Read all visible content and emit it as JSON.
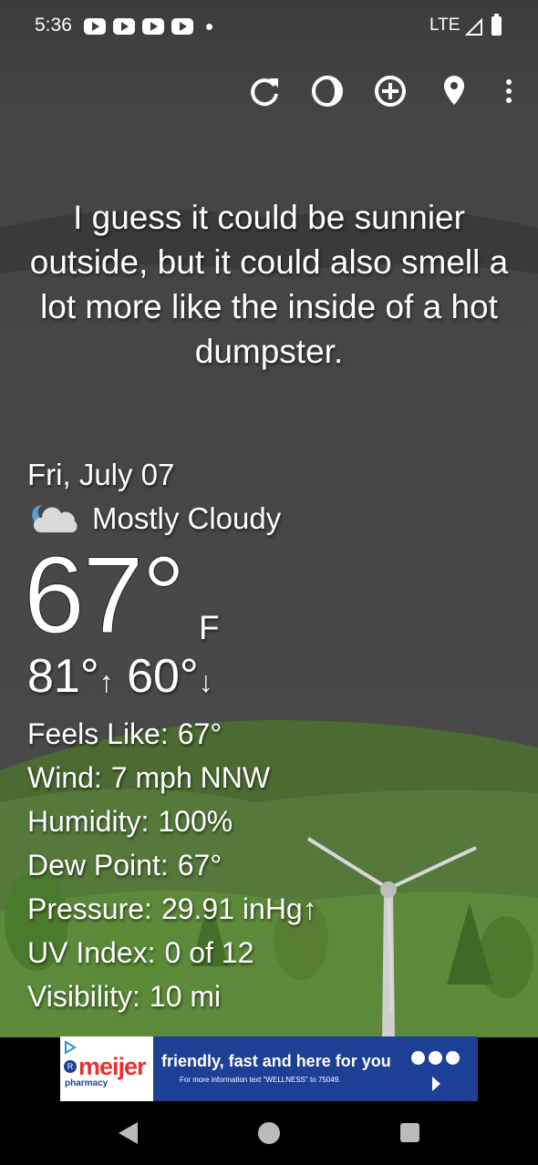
{
  "status_bar": {
    "time": "5:36",
    "notification_icons": [
      "youtube-icon",
      "youtube-icon",
      "youtube-icon",
      "youtube-icon"
    ],
    "network": "LTE"
  },
  "toolbar": {
    "icons": [
      "refresh-icon",
      "theme-icon",
      "add-location-icon",
      "location-pin-icon",
      "more-options-icon"
    ]
  },
  "quote": "I guess it could be sunnier outside, but it could also smell a lot more like the inside of a hot dumpster.",
  "weather": {
    "date": "Fri, July 07",
    "condition": "Mostly Cloudy",
    "condition_icon": "partly-cloudy-night-icon",
    "temperature": "67°",
    "unit": "F",
    "high": "81°",
    "high_arrow": "↑",
    "low": "60°",
    "low_arrow": "↓",
    "details": [
      {
        "label": "Feels Like:",
        "value": "67°"
      },
      {
        "label": "Wind:",
        "value": "7 mph NNW"
      },
      {
        "label": "Humidity:",
        "value": "100%"
      },
      {
        "label": "Dew Point:",
        "value": "67°"
      },
      {
        "label": "Pressure:",
        "value": "29.91 inHg↑"
      },
      {
        "label": "UV Index:",
        "value": "0 of 12"
      },
      {
        "label": "Visibility:",
        "value": "10 mi"
      }
    ]
  },
  "ad": {
    "brand": "meijer",
    "brand_sub": "pharmacy",
    "headline": "friendly, fast and here for you",
    "small_text": "For more information text \"WELLNESS\" to 75049."
  },
  "colors": {
    "ad_background": "#1d3f95",
    "brand_red": "#e4352f",
    "grass": "#5d8a3a"
  }
}
